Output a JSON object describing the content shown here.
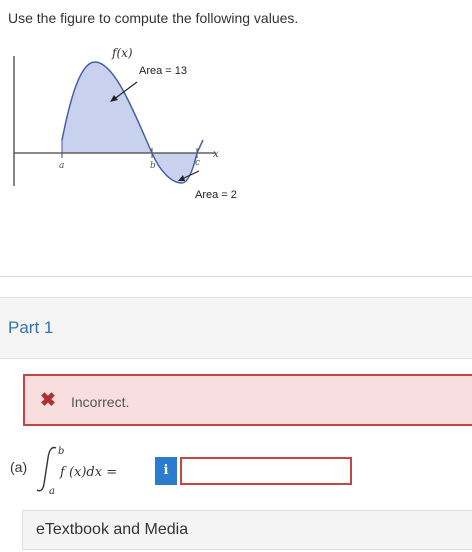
{
  "prompt": "Use the figure to compute the following values.",
  "figure": {
    "func_label": "f(x)",
    "area1_label": "Area = 13",
    "area2_label": "Area = 2",
    "x_axis_label": "x",
    "tick_a": "a",
    "tick_b": "b",
    "tick_c": "c",
    "fill_color": "#c8d2ee",
    "curve_color": "#4a5ea8"
  },
  "part": {
    "title": "Part 1"
  },
  "feedback": {
    "icon": "x-icon",
    "message": "Incorrect."
  },
  "question": {
    "label": "(a)",
    "upper_limit": "b",
    "lower_limit": "a",
    "integrand": "f (x)dx =",
    "info_label": "i",
    "answer_value": "",
    "answer_placeholder": ""
  },
  "etextbook": {
    "label": "eTextbook and Media"
  }
}
